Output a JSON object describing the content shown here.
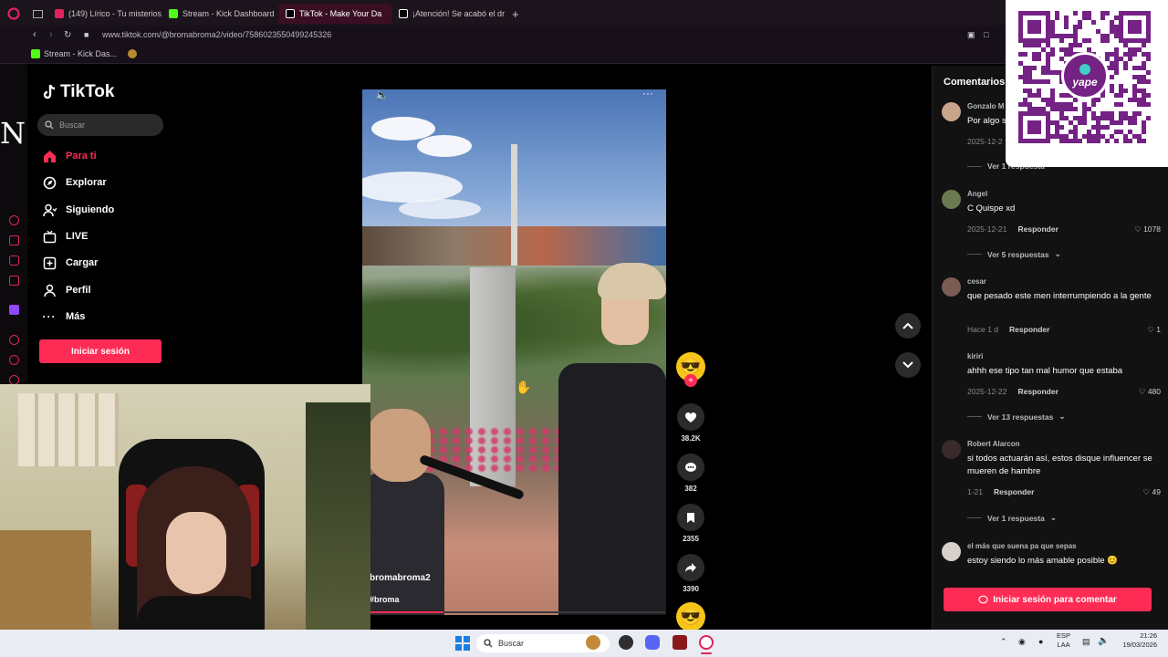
{
  "browser": {
    "tabs": [
      {
        "label": "(149) Lírico - Tu misterios",
        "color": "#e0245e"
      },
      {
        "label": "Stream - Kick Dashboard",
        "color": "#53fc18"
      },
      {
        "label": "TikTok - Make Your Da",
        "color": "#ffffff",
        "active": true
      },
      {
        "label": "¡Atención! Se acabó el dra",
        "color": "#ffffff"
      }
    ],
    "new_tab": "+",
    "url": "www.tiktok.com/@bromabroma2/video/7586023550499245326",
    "bookmarks": [
      {
        "label": "Stream - Kick Das..."
      }
    ]
  },
  "tiktok": {
    "logo": "TikTok",
    "search_placeholder": "Buscar",
    "nav": [
      {
        "label": "Para ti",
        "icon": "home-icon",
        "active": true
      },
      {
        "label": "Explorar",
        "icon": "compass-icon"
      },
      {
        "label": "Siguiendo",
        "icon": "user-follow-icon"
      },
      {
        "label": "LIVE",
        "icon": "live-icon"
      },
      {
        "label": "Cargar",
        "icon": "plus-square-icon"
      },
      {
        "label": "Perfil",
        "icon": "person-icon"
      },
      {
        "label": "Más",
        "icon": "more-icon"
      }
    ],
    "login_button": "Iniciar sesión",
    "side_letter": "N"
  },
  "video": {
    "author": "bromabroma2",
    "hashtag": "#broma",
    "progress": 0.25,
    "likes": "38.2K",
    "comments": "382",
    "saves": "2355",
    "shares": "3390"
  },
  "comments_panel": {
    "title": "Comentarios",
    "items": [
      {
        "user": "Gonzalo M",
        "text": "Por algo s",
        "date": "2025-12-2",
        "reply": "",
        "likes": "",
        "replies": "Ver 1 respuesta"
      },
      {
        "user": "Angel",
        "text": "C Quispe xd",
        "date": "2025-12-21",
        "reply": "Responder",
        "likes": "1078",
        "replies": "Ver 5 respuestas"
      },
      {
        "user": "cesar",
        "text": "que pesado este men interrumpiendo a la gente",
        "date": "Hace 1 d",
        "reply": "Responder",
        "likes": "1",
        "replies": ""
      },
      {
        "user": "kiriri",
        "text": "ahhh ese tipo tan mal humor que estaba",
        "date": "2025-12-22",
        "reply": "Responder",
        "likes": "480",
        "replies": "Ver 13 respuestas"
      },
      {
        "user": "Robert Alarcon",
        "text": "si todos actuarán así, estos disque influencer se mueren de hambre",
        "date": "1-21",
        "reply": "Responder",
        "likes": "49",
        "replies": "Ver 1 respuesta"
      },
      {
        "user": "el más que suena pa que sepas",
        "text": "estoy siendo lo más amable posible 😊",
        "date": "",
        "reply": "",
        "likes": "",
        "replies": ""
      }
    ],
    "login_button": "Iniciar sesión para comentar"
  },
  "qr": {
    "brand": "yape"
  },
  "taskbar": {
    "search": "Buscar",
    "lang": "ESP",
    "lang2": "LAA",
    "time": "21:26",
    "date": "19/03/2026"
  }
}
